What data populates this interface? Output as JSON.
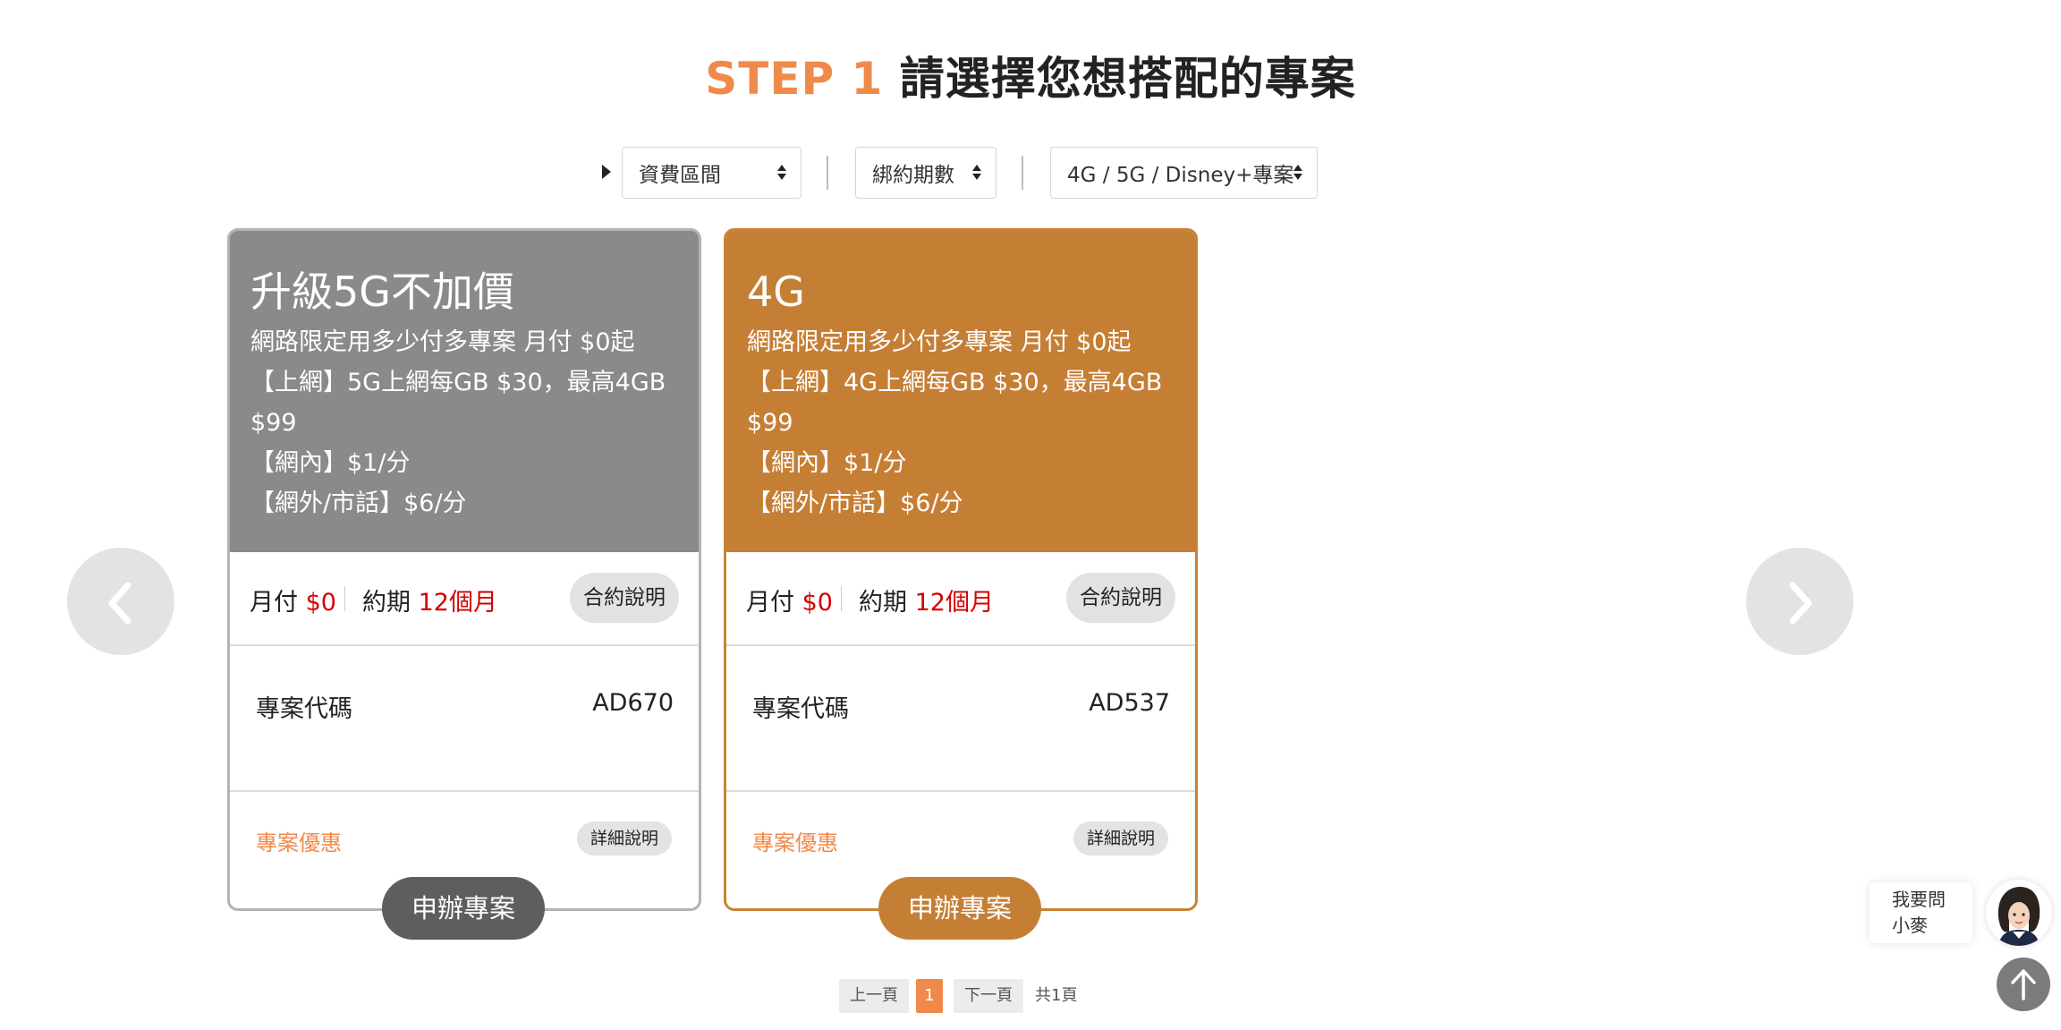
{
  "header": {
    "step": "STEP 1",
    "title": "請選擇您想搭配的專案"
  },
  "filters": {
    "fee_range": "資費區間",
    "contract_term": "綁約期數",
    "plan_type": "4G / 5G / Disney+專案"
  },
  "plans": [
    {
      "name": "升級5G不加價",
      "lines": [
        "網路限定用多少付多專案 月付 $0起",
        "【上網】5G上網每GB $30，最高4GB",
        "$99",
        "【網內】$1/分",
        "【網外/市話】$6/分"
      ],
      "monthly_label": "月付",
      "monthly_value": "$0",
      "term_label": "約期",
      "term_value": "12個月",
      "contract_button": "合約說明",
      "code_label": "專案代碼",
      "code_value": "AD670",
      "promo_label": "專案優惠",
      "detail_button": "詳細說明",
      "apply_button": "申辦專案",
      "color": "#8a8a8a"
    },
    {
      "name": "4G",
      "lines": [
        "網路限定用多少付多專案 月付 $0起",
        "【上網】4G上網每GB $30，最高4GB",
        "$99",
        "【網內】$1/分",
        "【網外/市話】$6/分"
      ],
      "monthly_label": "月付",
      "monthly_value": "$0",
      "term_label": "約期",
      "term_value": "12個月",
      "contract_button": "合約說明",
      "code_label": "專案代碼",
      "code_value": "AD537",
      "promo_label": "專案優惠",
      "detail_button": "詳細說明",
      "apply_button": "申辦專案",
      "color": "#c57f35"
    }
  ],
  "pagination": {
    "prev": "上一頁",
    "current": "1",
    "next": "下一頁",
    "total": "共1頁"
  },
  "chat": {
    "line1": "我要問",
    "line2": "小麥"
  },
  "icons": {
    "prev": "chevron-left-icon",
    "next": "chevron-right-icon",
    "back_to_top": "arrow-up-icon",
    "filter_toggle": "caret-right-icon"
  },
  "colors": {
    "accent": "#f08a4b",
    "price": "#d40000",
    "gray_card": "#8a8a8a",
    "orange_card": "#c57f35"
  }
}
